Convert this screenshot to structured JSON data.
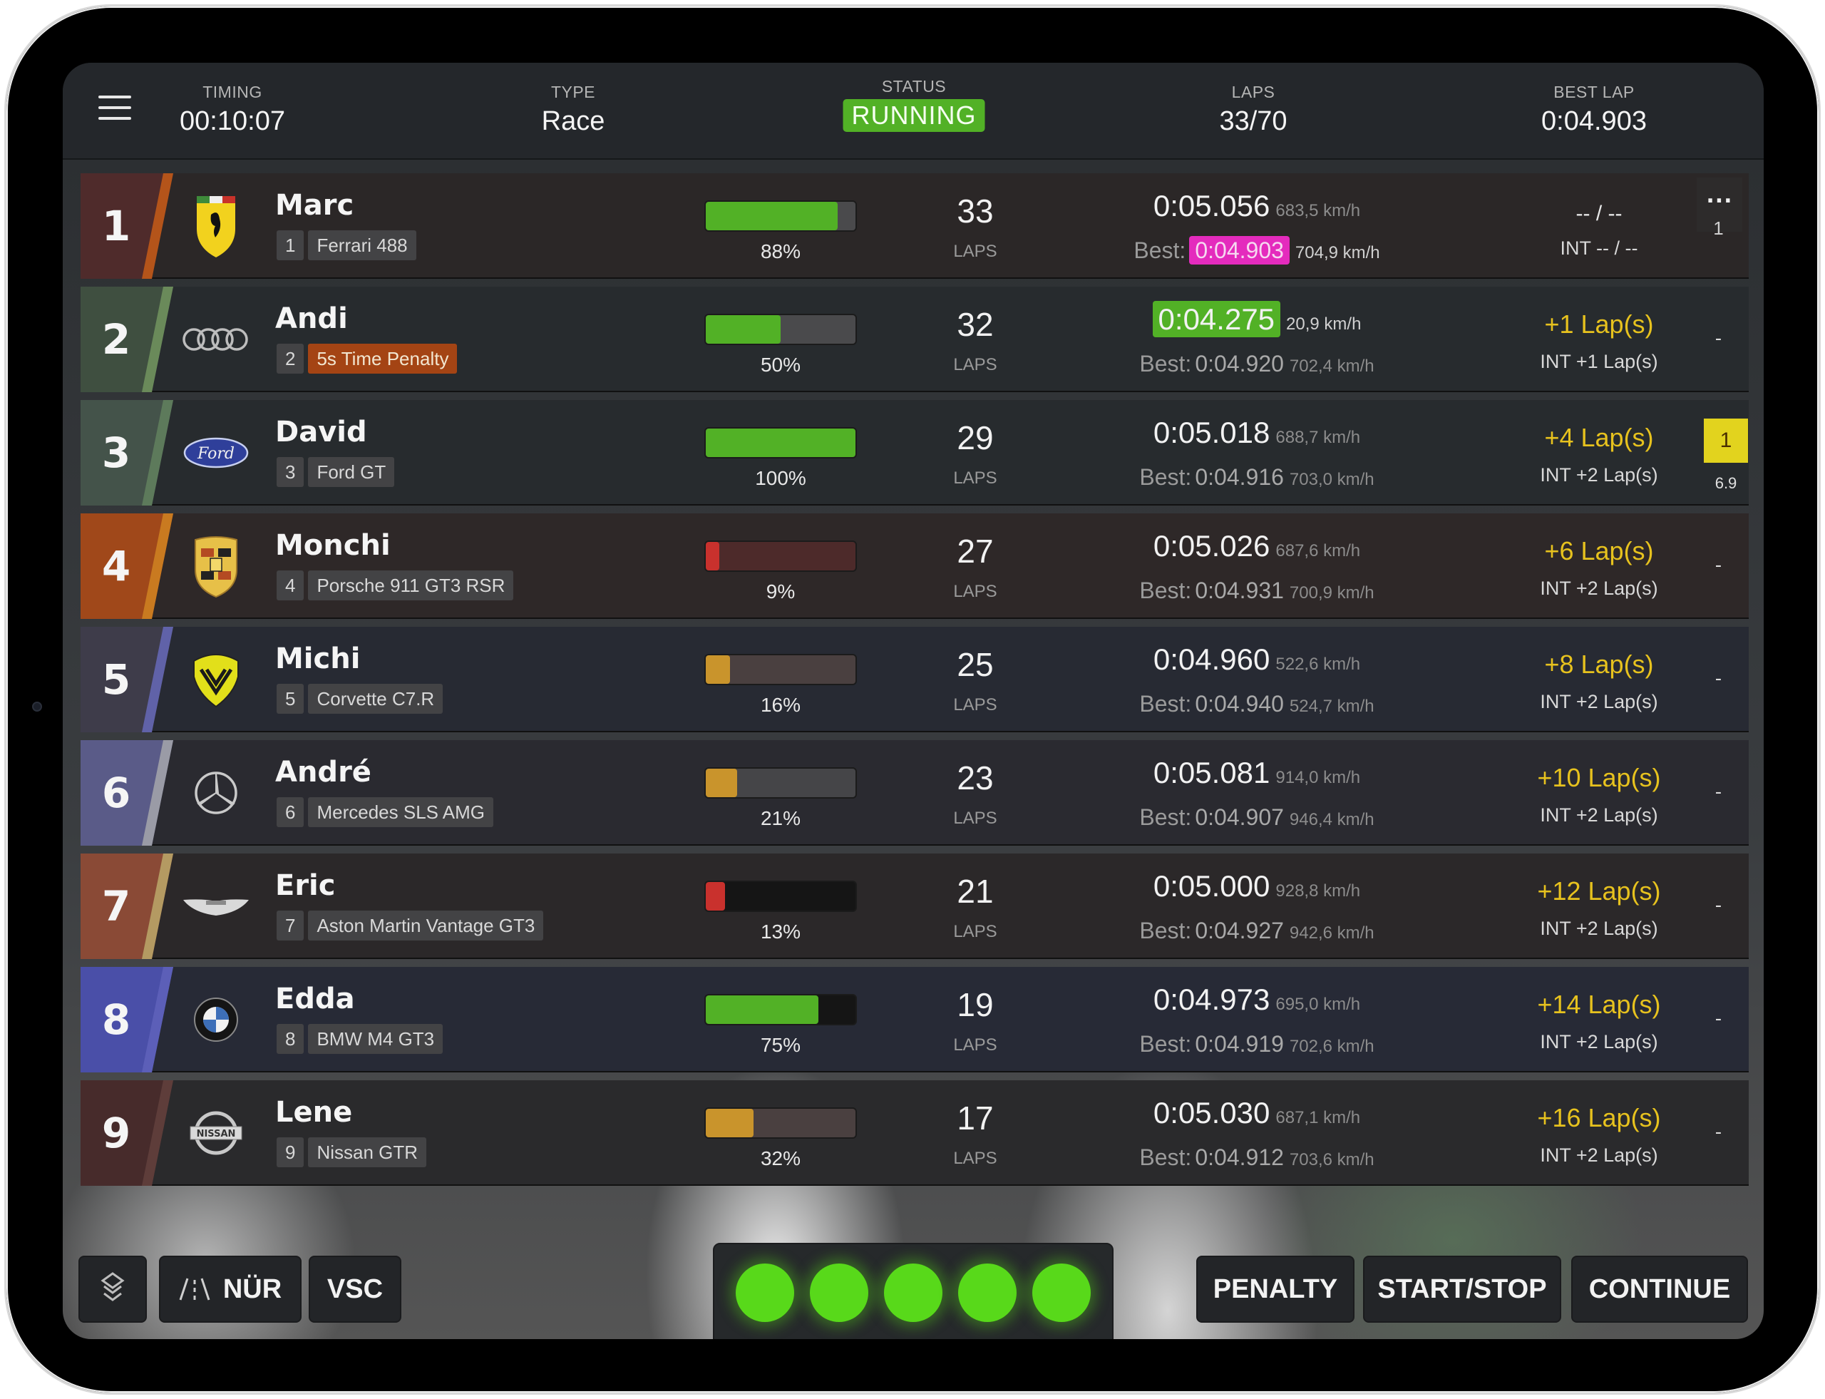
{
  "header": {
    "timing": {
      "label": "TIMING",
      "value": "00:10:07"
    },
    "type": {
      "label": "TYPE",
      "value": "Race"
    },
    "status": {
      "label": "STATUS",
      "value": "RUNNING"
    },
    "laps": {
      "label": "LAPS",
      "value": "33/70"
    },
    "best_lap": {
      "label": "BEST LAP",
      "value": "0:04.903"
    }
  },
  "colors": {
    "running": "#52b126",
    "personal_best": "#52b126",
    "overall_best": "#e42bbd",
    "penalty": "#a44414",
    "gap_text": "#e7c21e",
    "yellow_flag": "#e2d31e"
  },
  "rows": [
    {
      "position": "1",
      "logo": "ferrari-logo",
      "name": "Marc",
      "car_number": "1",
      "car": "Ferrari 488",
      "penalty": null,
      "progress_pct": 88,
      "progress_label": "88%",
      "progress_color": "#52b126",
      "progress_track": "#4a4a4c",
      "laps": "33",
      "laps_label": "LAPS",
      "last_lap": "0:05.056",
      "last_speed": "683,5 km/h",
      "last_highlight": "none",
      "best_label": "Best:",
      "best_lap": "0:04.903",
      "best_speed": "704,9 km/h",
      "best_highlight": "overall",
      "gap": "-- / --",
      "gap_style": "white",
      "int": "INT -- / --",
      "side": {
        "type": "more",
        "icon": "...",
        "value": "1"
      },
      "pos_bg": "#4f2b2b",
      "stripe": "#b4541a",
      "row_bg": "#2b2727"
    },
    {
      "position": "2",
      "logo": "audi-logo",
      "name": "Andi",
      "car_number": "2",
      "car": "",
      "penalty": "5s Time Penalty",
      "progress_pct": 50,
      "progress_label": "50%",
      "progress_color": "#52b126",
      "progress_track": "#4a4a4c",
      "laps": "32",
      "laps_label": "LAPS",
      "last_lap": "0:04.275",
      "last_speed": "20,9 km/h",
      "last_highlight": "personal",
      "best_label": "Best:",
      "best_lap": "0:04.920",
      "best_speed": "702,4 km/h",
      "best_highlight": "none",
      "gap": "+1 Lap(s)",
      "gap_style": "yellow",
      "int": "INT +1 Lap(s)",
      "side": {
        "type": "dash",
        "value": "-"
      },
      "pos_bg": "#3f4f40",
      "stripe": "#6a8a5a",
      "row_bg": "#272b2e"
    },
    {
      "position": "3",
      "logo": "ford-logo",
      "name": "David",
      "car_number": "3",
      "car": "Ford GT",
      "penalty": null,
      "progress_pct": 100,
      "progress_label": "100%",
      "progress_color": "#52b126",
      "progress_track": "#4a4a4c",
      "laps": "29",
      "laps_label": "LAPS",
      "last_lap": "0:05.018",
      "last_speed": "688,7 km/h",
      "last_highlight": "none",
      "best_label": "Best:",
      "best_lap": "0:04.916",
      "best_speed": "703,0 km/h",
      "best_highlight": "none",
      "gap": "+4 Lap(s)",
      "gap_style": "yellow",
      "int": "INT +2 Lap(s)",
      "side": {
        "type": "flag",
        "value": "1",
        "sub": "6.9"
      },
      "pos_bg": "#44534a",
      "stripe": "#5d7a5b",
      "row_bg": "#272b2e"
    },
    {
      "position": "4",
      "logo": "porsche-logo",
      "name": "Monchi",
      "car_number": "4",
      "car": "Porsche 911 GT3 RSR",
      "penalty": null,
      "progress_pct": 9,
      "progress_label": "9%",
      "progress_color": "#c9312d",
      "progress_track": "#4d2a2a",
      "laps": "27",
      "laps_label": "LAPS",
      "last_lap": "0:05.026",
      "last_speed": "687,6 km/h",
      "last_highlight": "none",
      "best_label": "Best:",
      "best_lap": "0:04.931",
      "best_speed": "700,9 km/h",
      "best_highlight": "none",
      "gap": "+6 Lap(s)",
      "gap_style": "yellow",
      "int": "INT +2 Lap(s)",
      "side": {
        "type": "dash",
        "value": "-"
      },
      "pos_bg": "#a0481a",
      "stripe": "#c97a20",
      "row_bg": "#2e2828"
    },
    {
      "position": "5",
      "logo": "mosler-logo",
      "name": "Michi",
      "car_number": "5",
      "car": "Corvette C7.R",
      "penalty": null,
      "progress_pct": 16,
      "progress_label": "16%",
      "progress_color": "#c9942c",
      "progress_track": "#4a4040",
      "laps": "25",
      "laps_label": "LAPS",
      "last_lap": "0:04.960",
      "last_speed": "522,6 km/h",
      "last_highlight": "none",
      "best_label": "Best:",
      "best_lap": "0:04.940",
      "best_speed": "524,7 km/h",
      "best_highlight": "none",
      "gap": "+8 Lap(s)",
      "gap_style": "yellow",
      "int": "INT +2 Lap(s)",
      "side": {
        "type": "dash",
        "value": "-"
      },
      "pos_bg": "#3e3c4a",
      "stripe": "#6062a8",
      "row_bg": "#272a33"
    },
    {
      "position": "6",
      "logo": "mercedes-logo",
      "name": "André",
      "car_number": "6",
      "car": "Mercedes SLS AMG",
      "penalty": null,
      "progress_pct": 21,
      "progress_label": "21%",
      "progress_color": "#c9942c",
      "progress_track": "#454548",
      "laps": "23",
      "laps_label": "LAPS",
      "last_lap": "0:05.081",
      "last_speed": "914,0 km/h",
      "last_highlight": "none",
      "best_label": "Best:",
      "best_lap": "0:04.907",
      "best_speed": "946,4 km/h",
      "best_highlight": "none",
      "gap": "+10 Lap(s)",
      "gap_style": "yellow",
      "int": "INT +2 Lap(s)",
      "side": {
        "type": "dash",
        "value": "-"
      },
      "pos_bg": "#5a5b88",
      "stripe": "#9a9ba6",
      "row_bg": "#2a2a30"
    },
    {
      "position": "7",
      "logo": "aston-martin-logo",
      "name": "Eric",
      "car_number": "7",
      "car": "Aston Martin Vantage GT3",
      "penalty": null,
      "progress_pct": 13,
      "progress_label": "13%",
      "progress_color": "#c9312d",
      "progress_track": "#151515",
      "laps": "21",
      "laps_label": "LAPS",
      "last_lap": "0:05.000",
      "last_speed": "928,8 km/h",
      "last_highlight": "none",
      "best_label": "Best:",
      "best_lap": "0:04.927",
      "best_speed": "942,6 km/h",
      "best_highlight": "none",
      "gap": "+12 Lap(s)",
      "gap_style": "yellow",
      "int": "INT +2 Lap(s)",
      "side": {
        "type": "dash",
        "value": "-"
      },
      "pos_bg": "#8a4a36",
      "stripe": "#b49a62",
      "row_bg": "#2b2829"
    },
    {
      "position": "8",
      "logo": "bmw-logo",
      "name": "Edda",
      "car_number": "8",
      "car": "BMW M4 GT3",
      "penalty": null,
      "progress_pct": 75,
      "progress_label": "75%",
      "progress_color": "#52b126",
      "progress_track": "#151515",
      "laps": "19",
      "laps_label": "LAPS",
      "last_lap": "0:04.973",
      "last_speed": "695,0 km/h",
      "last_highlight": "none",
      "best_label": "Best:",
      "best_lap": "0:04.919",
      "best_speed": "702,6 km/h",
      "best_highlight": "none",
      "gap": "+14 Lap(s)",
      "gap_style": "yellow",
      "int": "INT +2 Lap(s)",
      "side": {
        "type": "dash",
        "value": "-"
      },
      "pos_bg": "#4a4fa8",
      "stripe": "#5c5fb8",
      "row_bg": "#272a36"
    },
    {
      "position": "9",
      "logo": "nissan-logo",
      "name": "Lene",
      "car_number": "9",
      "car": "Nissan GTR",
      "penalty": null,
      "progress_pct": 32,
      "progress_label": "32%",
      "progress_color": "#c9942c",
      "progress_track": "#4a4040",
      "laps": "17",
      "laps_label": "LAPS",
      "last_lap": "0:05.030",
      "last_speed": "687,1 km/h",
      "last_highlight": "none",
      "best_label": "Best:",
      "best_lap": "0:04.912",
      "best_speed": "703,6 km/h",
      "best_highlight": "none",
      "gap": "+16 Lap(s)",
      "gap_style": "yellow",
      "int": "INT +2 Lap(s)",
      "side": {
        "type": "dash",
        "value": "-"
      },
      "pos_bg": "#472b2b",
      "stripe": "#5e3d3a",
      "row_bg": "#2a2a2c"
    }
  ],
  "bottom": {
    "layers_icon": "layers-icon",
    "track_icon": "road-icon",
    "track_label": "NÜR",
    "vsc_label": "VSC",
    "start_lights": [
      "green",
      "green",
      "green",
      "green",
      "green"
    ],
    "penalty_label": "PENALTY",
    "start_stop_label": "START/STOP",
    "continue_label": "CONTINUE"
  }
}
